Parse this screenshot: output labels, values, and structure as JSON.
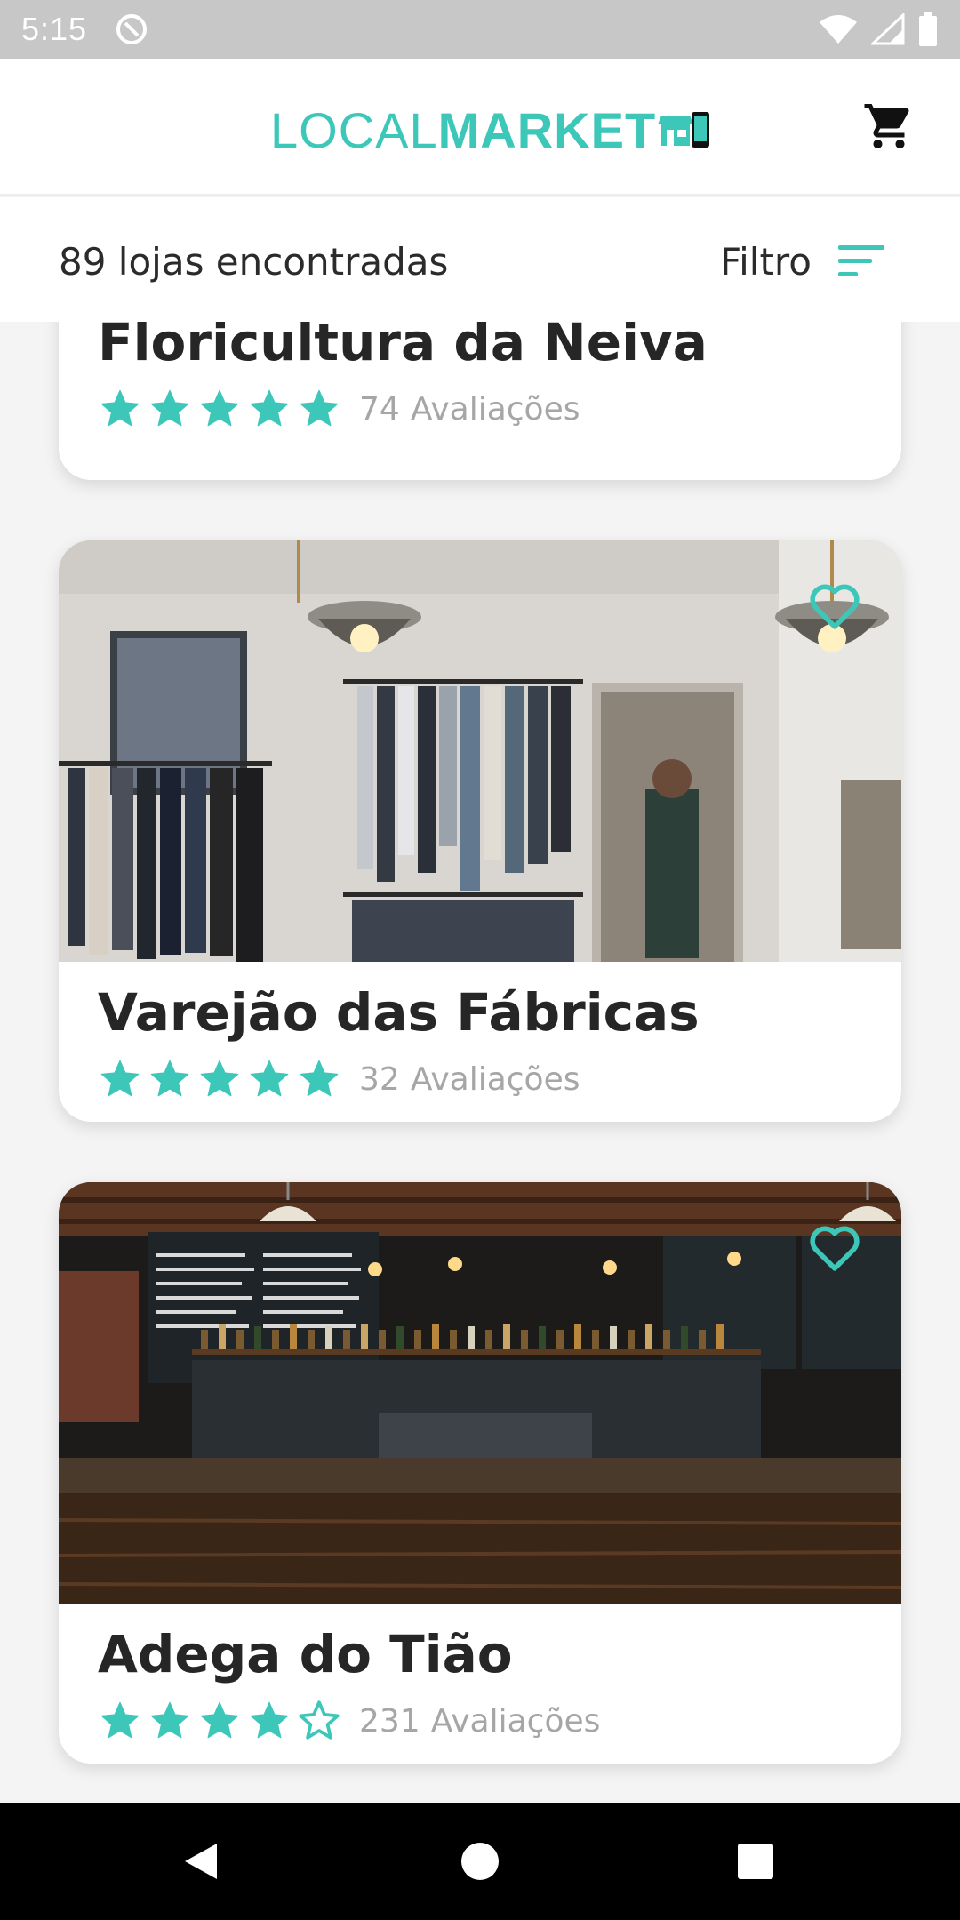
{
  "status_bar": {
    "time": "5:15",
    "icons": [
      "sync-off-icon",
      "wifi-icon",
      "signal-icon",
      "battery-icon"
    ]
  },
  "header": {
    "logo_local": "LOCAL",
    "logo_market": "MARKET",
    "cart_icon": "cart-icon"
  },
  "subheader": {
    "results": "89 lojas encontradas",
    "filter_label": "Filtro",
    "filter_icon": "filter-lines-icon"
  },
  "stores": [
    {
      "name": "Floricultura da Neiva",
      "rating": 5,
      "reviews": "74",
      "reviews_label": "Avaliações"
    },
    {
      "name": "Varejão das Fábricas",
      "rating": 5,
      "reviews": "32",
      "reviews_label": "Avaliações"
    },
    {
      "name": "Adega do Tião",
      "rating": 4,
      "reviews": "231",
      "reviews_label": "Avaliações"
    }
  ],
  "colors": {
    "accent": "#3cc7b9",
    "text": "#262626",
    "muted": "#a6a6a6"
  },
  "nav": {
    "icons": [
      "back-icon",
      "home-icon",
      "recents-icon"
    ]
  }
}
